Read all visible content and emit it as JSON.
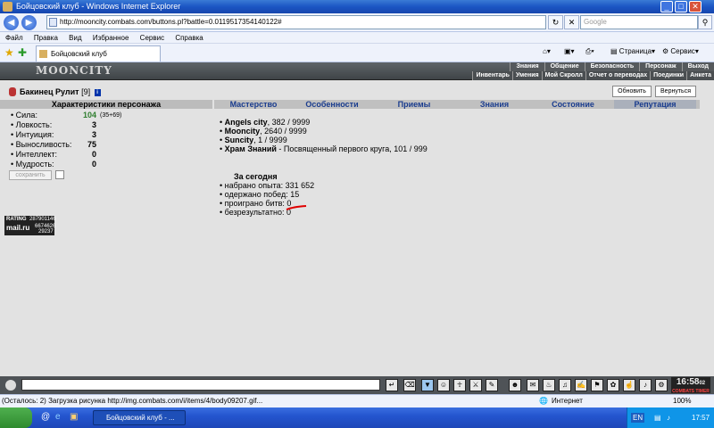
{
  "window": {
    "title": "Бойцовский клуб - Windows Internet Explorer",
    "min": "_",
    "max": "□",
    "close": "✕"
  },
  "address": {
    "url": "http://mooncity.combats.com/buttons.pl?battle=0.0119517354140122#",
    "search_placeholder": "Google"
  },
  "menu": [
    "Файл",
    "Правка",
    "Вид",
    "Избранное",
    "Сервис",
    "Справка"
  ],
  "browser_tab": {
    "title": "Бойцовский клуб"
  },
  "toolbar_right": {
    "page": "Страница",
    "tools": "Сервис"
  },
  "game": {
    "logo": "MOONCITY",
    "topmenu": [
      "Знания",
      "Общение",
      "Безопасность",
      "Персонаж",
      "Выход"
    ],
    "submenu": [
      "Инвентарь",
      "Умения",
      "Мой Скролл",
      "Отчет о переводах",
      "Поединки",
      "Анкета"
    ],
    "char": {
      "name": "Бакинец Рулит",
      "level": "[9]",
      "info": "i"
    },
    "buttons": {
      "refresh": "Обновить",
      "back": "Вернуться"
    },
    "char_header": "Характеристики персонажа",
    "stats": [
      {
        "label": "Сила:",
        "value": "104",
        "bonus": "(35+69)"
      },
      {
        "label": "Ловкость:",
        "value": "3",
        "bonus": ""
      },
      {
        "label": "Интуиция:",
        "value": "3",
        "bonus": ""
      },
      {
        "label": "Выносливость:",
        "value": "75",
        "bonus": ""
      },
      {
        "label": "Интеллект:",
        "value": "0",
        "bonus": ""
      },
      {
        "label": "Мудрость:",
        "value": "0",
        "bonus": ""
      }
    ],
    "save": "сохранить",
    "counter": {
      "brand1": "RATING",
      "v1": "287901146",
      "brand2": "mail.ru",
      "v2": "6674626",
      "v3": "29237"
    },
    "tabs": [
      "Мастерство",
      "Особенности",
      "Приемы",
      "Знания",
      "Состояние",
      "Репутация"
    ],
    "reputation": [
      {
        "city": "Angels city",
        "value": ", 382 / 9999"
      },
      {
        "city": "Mooncity",
        "value": ", 2640 / 9999"
      },
      {
        "city": "Suncity",
        "value": ", 1 / 9999"
      },
      {
        "city": "Храм Знаний",
        "value": " - Посвященный первого круга, 101 / 999"
      }
    ],
    "today": {
      "title": "За сегодня",
      "lines": [
        "набрано опыта: 331 652",
        "одержано побед: 15",
        "проиграно битв: 0",
        "безрезультатно: 0"
      ]
    },
    "clock": {
      "time": "16:58",
      "sec": "02",
      "label": "COMBATS TIMER"
    }
  },
  "status": {
    "text": "(Осталось: 2) Загрузка рисунка http://img.combats.com/i/items/4/body09207.gif...",
    "zone": "Интернет",
    "zoom": "100%"
  },
  "taskbar": {
    "task": "Бойцовский клуб - ...",
    "lang": "EN",
    "time": "17:57"
  }
}
